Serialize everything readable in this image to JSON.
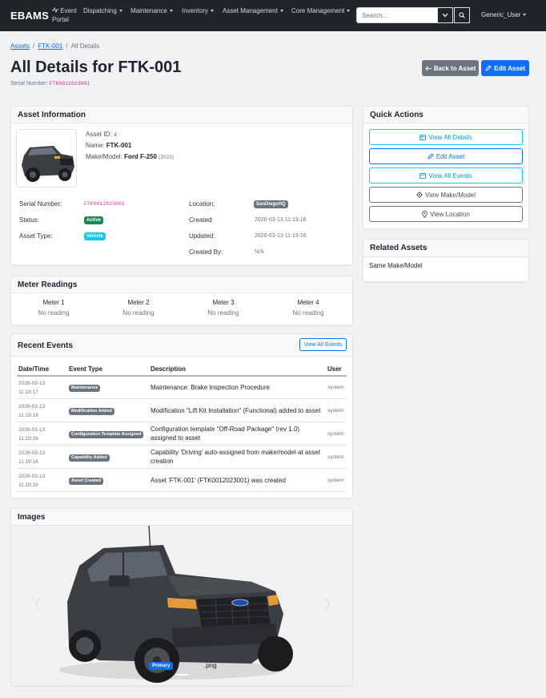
{
  "navbar": {
    "brand": "EBAMS",
    "items": [
      {
        "label": "Event",
        "label2": "Portal"
      },
      {
        "label": "Dispatching"
      },
      {
        "label": "Maintenance"
      },
      {
        "label": "Inventory"
      },
      {
        "label": "Asset Management"
      },
      {
        "label": "Core Management"
      }
    ],
    "search_placeholder": "Search...",
    "user": "Generic_User"
  },
  "breadcrumb": [
    "Assets",
    "FTK-001",
    "All Details"
  ],
  "page": {
    "title": "All Details for FTK-001",
    "serial_label": "Serial Number:",
    "serial_value": "FTK0012023001",
    "back_button": "Back to Asset",
    "edit_button": "Edit Asset"
  },
  "asset_info": {
    "header": "Asset Information",
    "asset_id_label": "Asset ID:",
    "asset_id": "4",
    "name_label": "Name:",
    "name": "FTK-001",
    "make_model_label": "Make/Model:",
    "make_model": "Ford F-250",
    "year": "(2023)",
    "serial_label": "Serial Number:",
    "serial": "FTK0012023001",
    "status_label": "Status:",
    "status": "Active",
    "type_label": "Asset Type:",
    "type": "Vehicle",
    "location_label": "Location:",
    "location": "SanDiegoHQ",
    "created_label": "Created:",
    "created": "2026-03-13 11:19:16",
    "updated_label": "Updated:",
    "updated": "2026-03-13 11:19:16",
    "created_by_label": "Created By:",
    "created_by": "N/A"
  },
  "meters": {
    "header": "Meter Readings",
    "items": [
      {
        "title": "Meter 1",
        "reading": "No reading"
      },
      {
        "title": "Meter 2",
        "reading": "No reading"
      },
      {
        "title": "Meter 3",
        "reading": "No reading"
      },
      {
        "title": "Meter 4",
        "reading": "No reading"
      }
    ]
  },
  "events": {
    "header": "Recent Events",
    "view_all": "View All Events",
    "columns": [
      "Date/Time",
      "Event Type",
      "Description",
      "User"
    ],
    "rows": [
      {
        "date": "2026-03-13",
        "time": "11:19:17",
        "type": "Maintenance",
        "desc": "Maintenance: Brake Inspection Procedure",
        "user": "system"
      },
      {
        "date": "2026-03-13",
        "time": "11:19:16",
        "type": "Modification Added",
        "desc": "Modification \"Lift Kit Installation\" (Functional) added to asset",
        "user": "system"
      },
      {
        "date": "2026-03-13",
        "time": "11:19:16",
        "type": "Configuration Template Assigned",
        "desc": "Configuration template \"Off-Road Package\" (rev 1.0) assigned to asset",
        "user": "system"
      },
      {
        "date": "2026-03-13",
        "time": "11:19:16",
        "type": "Capability Added",
        "desc": "Capability 'Driving' auto-assigned from make/model at asset creation",
        "user": "system"
      },
      {
        "date": "2026-03-13",
        "time": "11:19:16",
        "type": "Asset Created",
        "desc": "Asset 'FTK-001' (FTK0012023001) was created",
        "user": "system"
      }
    ]
  },
  "images": {
    "header": "Images",
    "primary_badge": "Primary",
    "filename": ".png"
  },
  "quick_actions": {
    "header": "Quick Actions",
    "buttons": [
      "View All Details",
      "Edit Asset",
      "View All Events",
      "View Make/Model",
      "View Location"
    ]
  },
  "related": {
    "header": "Related Assets",
    "same_make_model": "Same Make/Model"
  },
  "colors": {
    "navbar": "#212529",
    "primary": "#0d6efd",
    "secondary": "#6c757d",
    "success": "#198754",
    "info": "#0dcaf0",
    "code": "#d63384"
  }
}
